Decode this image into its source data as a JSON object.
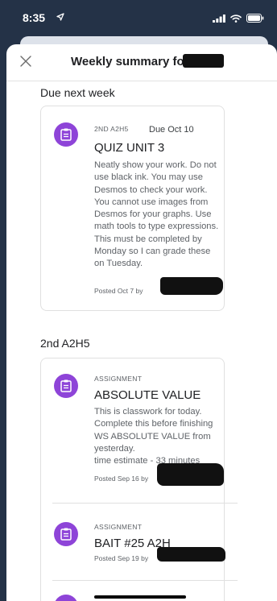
{
  "status_bar": {
    "time": "8:35"
  },
  "sheet": {
    "title": "Weekly summary for"
  },
  "sections": [
    {
      "title": "Due next week",
      "items": [
        {
          "type": "2ND A2H5",
          "due": "Due Oct 10",
          "title": "QUIZ UNIT 3",
          "description": "Neatly show your work. Do not use black ink. You may use Desmos to check your work. You cannot use images from Desmos for your graphs. Use math tools to type expressions. This must be completed by Monday so I can grade these on Tuesday.",
          "posted": "Posted Oct 7 by"
        }
      ]
    },
    {
      "title": "2nd A2H5",
      "items": [
        {
          "type": "ASSIGNMENT",
          "title": "ABSOLUTE VALUE",
          "description": "This is classwork for today. Complete this before finishing WS ABSOLUTE VALUE from yesterday.",
          "time_estimate": "time estimate - 33 minutes",
          "posted": "Posted Sep 16 by"
        },
        {
          "type": "ASSIGNMENT",
          "title": "BAIT #25 A2H",
          "posted": "Posted Sep 19 by"
        }
      ]
    }
  ],
  "colors": {
    "accent": "#8e44d8",
    "background": "#243247"
  },
  "icons": {
    "close": "close-icon",
    "assignment": "assignment-icon",
    "location": "location-arrow-icon",
    "signal": "signal-icon",
    "wifi": "wifi-icon",
    "battery": "battery-icon"
  }
}
